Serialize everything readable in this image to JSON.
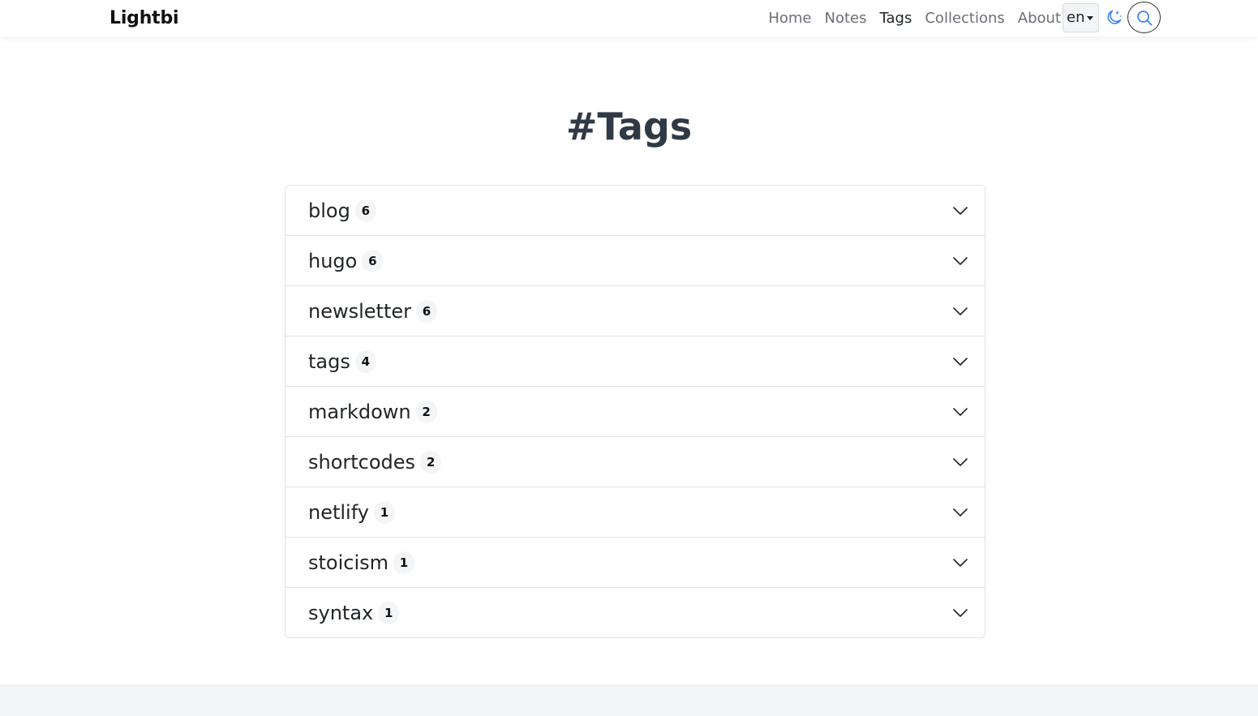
{
  "navbar": {
    "brand": "Lightbi",
    "links": [
      {
        "label": "Home",
        "active": false
      },
      {
        "label": "Notes",
        "active": false
      },
      {
        "label": "Tags",
        "active": true
      },
      {
        "label": "Collections",
        "active": false
      },
      {
        "label": "About",
        "active": false
      }
    ],
    "language": "en",
    "theme_icon": "moon-sparkle-icon",
    "search_icon": "search-icon",
    "accent_color": "#3b82f6"
  },
  "main": {
    "title": "#Tags",
    "tags": [
      {
        "name": "blog",
        "count": "6"
      },
      {
        "name": "hugo",
        "count": "6"
      },
      {
        "name": "newsletter",
        "count": "6"
      },
      {
        "name": "tags",
        "count": "4"
      },
      {
        "name": "markdown",
        "count": "2"
      },
      {
        "name": "shortcodes",
        "count": "2"
      },
      {
        "name": "netlify",
        "count": "1"
      },
      {
        "name": "stoicism",
        "count": "1"
      },
      {
        "name": "syntax",
        "count": "1"
      }
    ]
  }
}
